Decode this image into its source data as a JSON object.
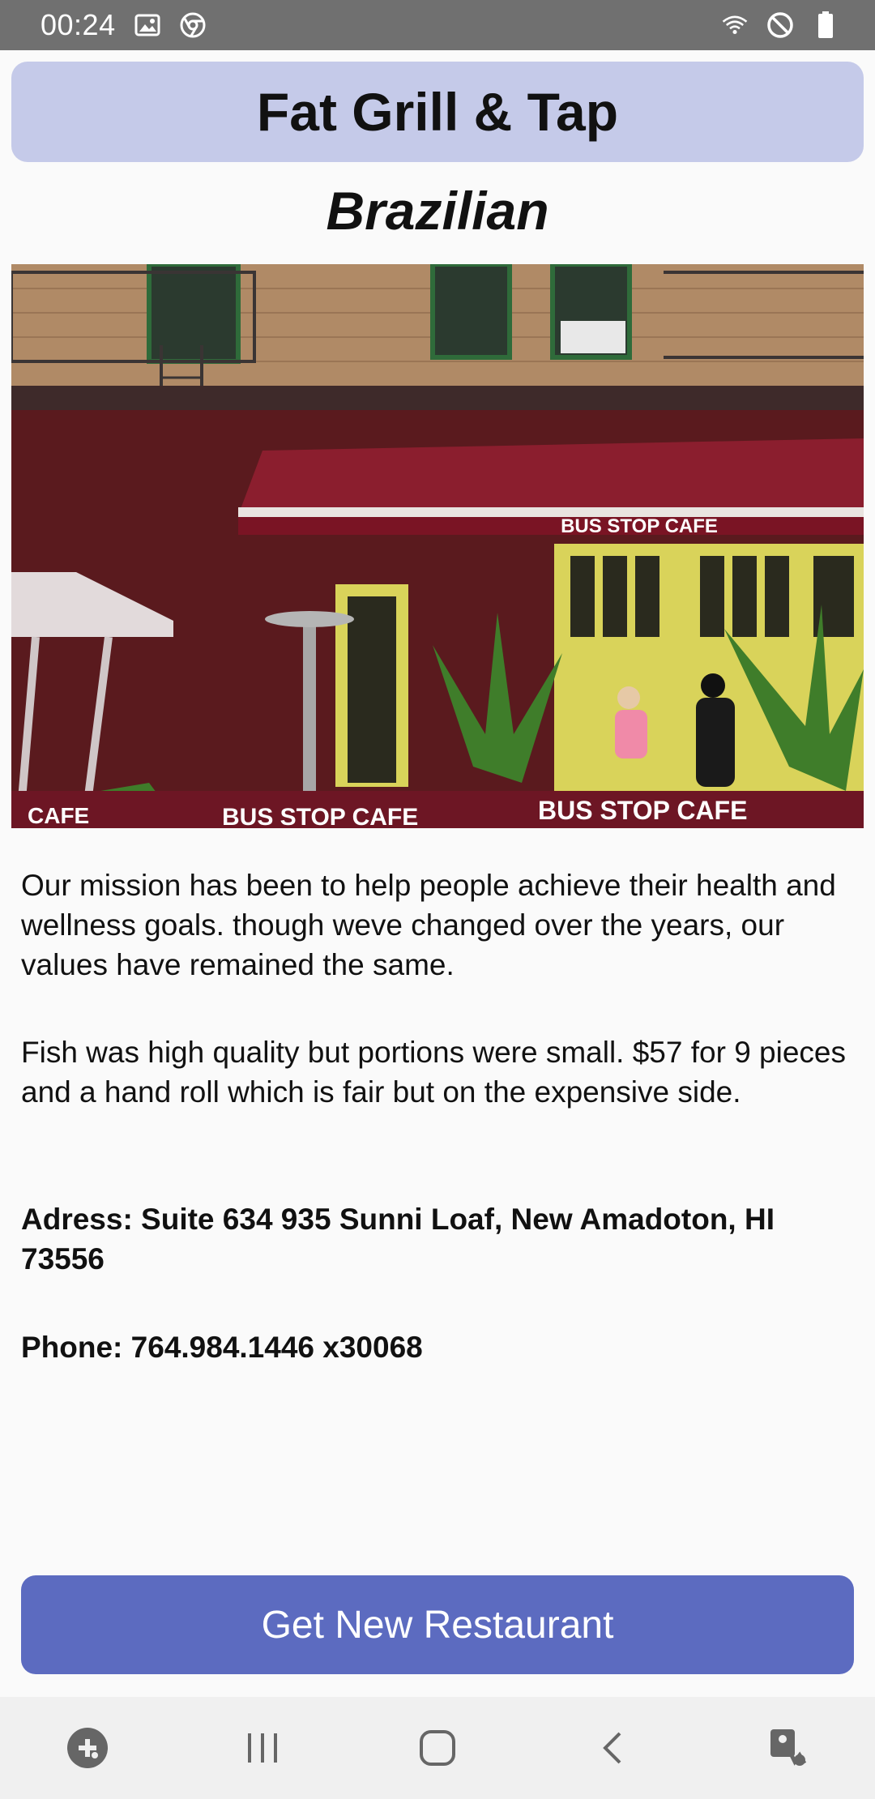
{
  "status_bar": {
    "time": "00:24",
    "left_icons": [
      "gallery-icon",
      "chrome-icon"
    ],
    "right_icons": [
      "wifi-icon",
      "do-not-disturb-icon",
      "battery-icon"
    ]
  },
  "restaurant": {
    "name": "Fat Grill & Tap",
    "cuisine": "Brazilian",
    "photo": {
      "awning_sign": "BUS STOP CAFE",
      "banner_signs": [
        "CAFE",
        "BUS STOP CAFE",
        "BUS STOP CAFE"
      ]
    },
    "mission": "Our mission has been to help people achieve their health and wellness goals. though weve changed over the years, our values have remained the same.",
    "review": "Fish was high quality but portions were small. $57 for 9 pieces and a hand roll which is fair but on the expensive side.",
    "address": "Adress: Suite 634 935 Sunni Loaf, New Amadoton, HI 73556",
    "phone": "Phone: 764.984.1446 x30068"
  },
  "actions": {
    "new_restaurant_label": "Get New Restaurant"
  },
  "nav_bar": {
    "buttons": [
      "game-launcher-icon",
      "recent-apps-icon",
      "home-icon",
      "back-icon",
      "accessibility-icon"
    ]
  },
  "colors": {
    "title_bg": "#c5cae9",
    "button_bg": "#5c6bc0",
    "status_bar_bg": "#707070"
  }
}
